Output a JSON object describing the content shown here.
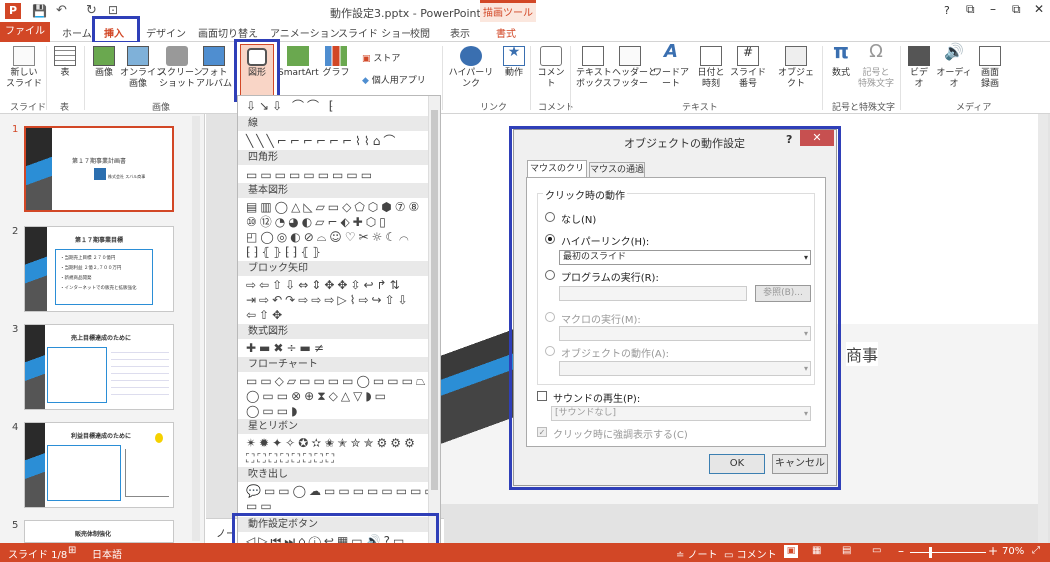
{
  "app": {
    "title": "動作設定3.pptx - PowerPoint",
    "context_tab_group": "描画ツール",
    "help": "?"
  },
  "tabs": [
    "ファイル",
    "ホーム",
    "挿入",
    "デザイン",
    "画面切り替え",
    "アニメーション",
    "スライド ショー",
    "校閲",
    "表示",
    "書式"
  ],
  "ribbon": {
    "new_slide": "新しい\nスライド",
    "table": "表",
    "image": "画像",
    "online_image": "オンライン\n画像",
    "screenshot": "スクリーン\nショット",
    "album": "フォト\nアルバム",
    "shapes": "図形",
    "smartart": "SmartArt",
    "graph": "グラフ",
    "store": "ストア",
    "personal_apps": "個人用アプリ",
    "hyperlink": "ハイパーリンク",
    "action": "動作",
    "comment": "コメント",
    "textbox": "テキスト\nボックス",
    "header_footer": "ヘッダーと\nフッター",
    "wordart": "ワードアート",
    "datetime": "日付と\n時刻",
    "slide_number": "スライド番号",
    "object": "オブジェクト",
    "equation": "数式",
    "symbol": "記号と\n特殊文字",
    "video": "ビデオ",
    "audio": "オーディオ",
    "screen_record": "画面\n録画",
    "groups": [
      "スライド",
      "表",
      "画像",
      "リンク",
      "コメント",
      "テキスト",
      "記号と特殊文字",
      "メディア"
    ]
  },
  "shapes_panel": {
    "categories": [
      "線",
      "四角形",
      "基本図形",
      "ブロック矢印",
      "数式図形",
      "フローチャート",
      "星とリボン",
      "吹き出し",
      "動作設定ボタン"
    ],
    "rows": {
      "recent": "⇩↘⇩ ⌒⌒ ⁅",
      "lines": "╲╲╲⌐⌐⌐⌐⌐⌐⌇⌇⌂⌒",
      "rects": "▭▭▭▭▭▭▭▭▭",
      "basic1": "▤▥◯△◺▱▭◇⬠⬡⬢⑦⑧",
      "basic2": "⑩⑫◔◕◐▱⌐⬖✚⬡▯",
      "basic3": "◰◯◎◐⊘⌓☺♡✂☼☾⌒",
      "basic4": "⁅⁆⦃⦄⁅⁆⦃⦄",
      "arrows1": "⇨⇦⇧⇩⇔⇕✥✥⇳↩↱⇅",
      "arrows2": "⇥⇨↶↷⇨⇨⇨▷⌇⇨↪⇧⇩",
      "arrows3": "⇦⇧✥",
      "math": "✚▬✖÷▬≠",
      "flow1": "▭▭◇▱▭▭▭▭◯▭▭▭⏢",
      "flow2": "◯▭▭⊗⊕⧗◇△▽◗▭",
      "flow3": "◯▭▭◗",
      "stars1": "✴✹✦✧✪✫✬✭✮✯⚙⚙⚙",
      "stars2": "⛶⛶⛶⛶⛶⛶⛶⛶",
      "callouts": "💬▭▭◯☁▭▭▭▭▭▭▭▭",
      "callouts2": "▭▭",
      "action": "◁▷⏮⏭⌂ⓘ↩▦▭🔊?▭"
    }
  },
  "slides": [
    {
      "num": "1",
      "title": "第１７期事業計画書",
      "sub": "株式会社 スバル商事"
    },
    {
      "num": "2",
      "title": "第１７期事業目標",
      "lines": [
        "・当期売上目標 ２７０億円",
        "・当期利益 ２億２,７００万円",
        "・新規商品開発",
        "・インターネットでの販売と拡販強化"
      ]
    },
    {
      "num": "3",
      "title": "売上目標達成のために"
    },
    {
      "num": "4",
      "title": "利益目標達成のために"
    },
    {
      "num": "5",
      "title": "販売体制強化"
    }
  ],
  "slide_text": "商事",
  "notes": "ノート",
  "dialog": {
    "title": "オブジェクトの動作設定",
    "help": "?",
    "tabs": [
      "マウスのクリック",
      "マウスの通過"
    ],
    "group_label": "クリック時の動作",
    "opt_none": "なし(N)",
    "opt_hyperlink": "ハイパーリンク(H):",
    "hyperlink_value": "最初のスライド",
    "opt_program": "プログラムの実行(R):",
    "browse": "参照(B)...",
    "opt_macro": "マクロの実行(M):",
    "opt_object": "オブジェクトの動作(A):",
    "sound": "サウンドの再生(P):",
    "sound_value": "[サウンドなし]",
    "highlight": "クリック時に強調表示する(C)",
    "ok": "OK",
    "cancel": "キャンセル"
  },
  "status": {
    "slide": "スライド 1/8",
    "lang": "日本語",
    "notes": "ノート",
    "comments": "コメント",
    "zoom": "70%"
  },
  "colors": {
    "accent": "#d24726",
    "highlight": "#2f3fb8"
  }
}
